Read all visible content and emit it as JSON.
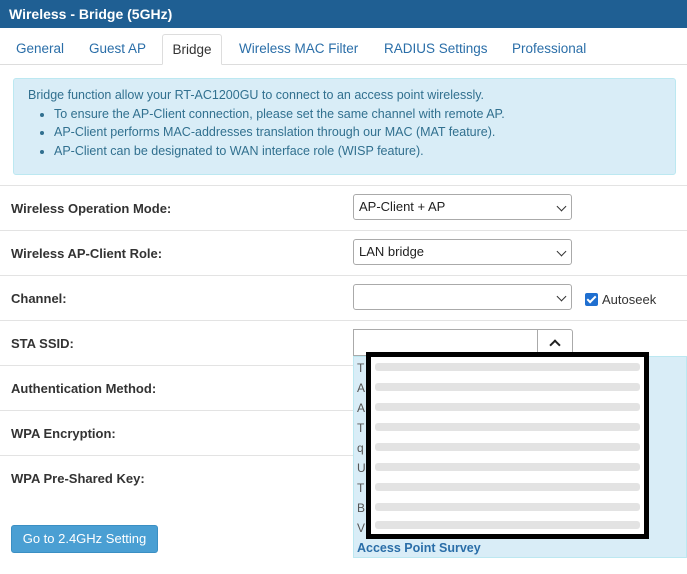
{
  "window": {
    "title": "Wireless - Bridge (5GHz)"
  },
  "tabs": [
    {
      "label": "General"
    },
    {
      "label": "Guest AP"
    },
    {
      "label": "Bridge"
    },
    {
      "label": "Wireless MAC Filter"
    },
    {
      "label": "RADIUS Settings"
    },
    {
      "label": "Professional"
    }
  ],
  "active_tab": "Bridge",
  "info": {
    "intro": "Bridge function allow your RT-AC1200GU to connect to an access point wirelessly.",
    "bullets": [
      "To ensure the AP-Client connection, please set the same channel with remote AP.",
      "AP-Client performs MAC-addresses translation through our MAC (MAT feature).",
      "AP-Client can be designated to WAN interface role (WISP feature)."
    ]
  },
  "form": {
    "operation_mode": {
      "label": "Wireless Operation Mode:",
      "value": "AP-Client + AP"
    },
    "client_role": {
      "label": "Wireless AP-Client Role:",
      "value": "LAN bridge"
    },
    "channel": {
      "label": "Channel:",
      "value": "",
      "autoseek_label": "Autoseek",
      "autoseek_checked": true
    },
    "sta_ssid": {
      "label": "STA SSID:",
      "value": ""
    },
    "auth_method": {
      "label": "Authentication Method:"
    },
    "wpa_encryption": {
      "label": "WPA Encryption:"
    },
    "wpa_psk": {
      "label": "WPA Pre-Shared Key:"
    }
  },
  "survey": {
    "items": [
      "T",
      "A",
      "A",
      "T",
      "q",
      "U",
      "T",
      "B",
      "V"
    ],
    "footer": "Access Point Survey"
  },
  "buttons": {
    "goto_24": "Go to 2.4GHz Setting"
  },
  "colors": {
    "header": "#1f5f93",
    "info_bg": "#d9edf7",
    "link": "#2a6ea8",
    "button": "#4a9fd3"
  }
}
